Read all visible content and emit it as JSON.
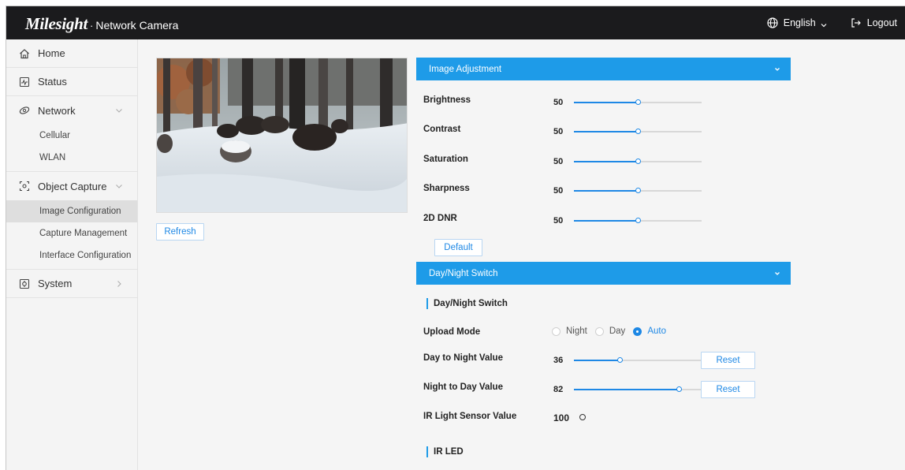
{
  "header": {
    "brand_logo": "Milesight",
    "brand_separator": "·",
    "product": "Network Camera",
    "language": "English",
    "logout": "Logout",
    "language_icon": "globe-icon",
    "logout_icon": "logout-icon"
  },
  "sidebar": {
    "home": "Home",
    "status": "Status",
    "network": "Network",
    "network_sub": [
      "Cellular",
      "WLAN"
    ],
    "object_capture": "Object Capture",
    "object_capture_sub": [
      "Image Configuration",
      "Capture Management",
      "Interface Configuration"
    ],
    "active_sub": "Image Configuration",
    "system": "System"
  },
  "preview": {
    "refresh_label": "Refresh"
  },
  "image_adjustment": {
    "title": "Image Adjustment",
    "rows": [
      {
        "label": "Brightness",
        "value": "50",
        "fraction": 0.5
      },
      {
        "label": "Contrast",
        "value": "50",
        "fraction": 0.5
      },
      {
        "label": "Saturation",
        "value": "50",
        "fraction": 0.5
      },
      {
        "label": "Sharpness",
        "value": "50",
        "fraction": 0.5
      },
      {
        "label": "2D DNR",
        "value": "50",
        "fraction": 0.5
      }
    ],
    "default_label": "Default"
  },
  "day_night": {
    "title": "Day/Night Switch",
    "section_title": "Day/Night Switch",
    "upload_mode_label": "Upload Mode",
    "modes": [
      "Night",
      "Day",
      "Auto"
    ],
    "selected_mode": "Auto",
    "day_to_night_label": "Day to Night Value",
    "day_to_night_value": "36",
    "day_to_night_fraction": 0.36,
    "night_to_day_label": "Night to Day Value",
    "night_to_day_value": "82",
    "night_to_day_fraction": 0.82,
    "reset_label": "Reset",
    "ir_sensor_label": "IR Light Sensor Value",
    "ir_sensor_value": "100",
    "ir_led_title": "IR LED"
  },
  "colors": {
    "accent": "#1e9be8",
    "header_bg": "#1b1b1d",
    "link": "#1e88e5"
  }
}
